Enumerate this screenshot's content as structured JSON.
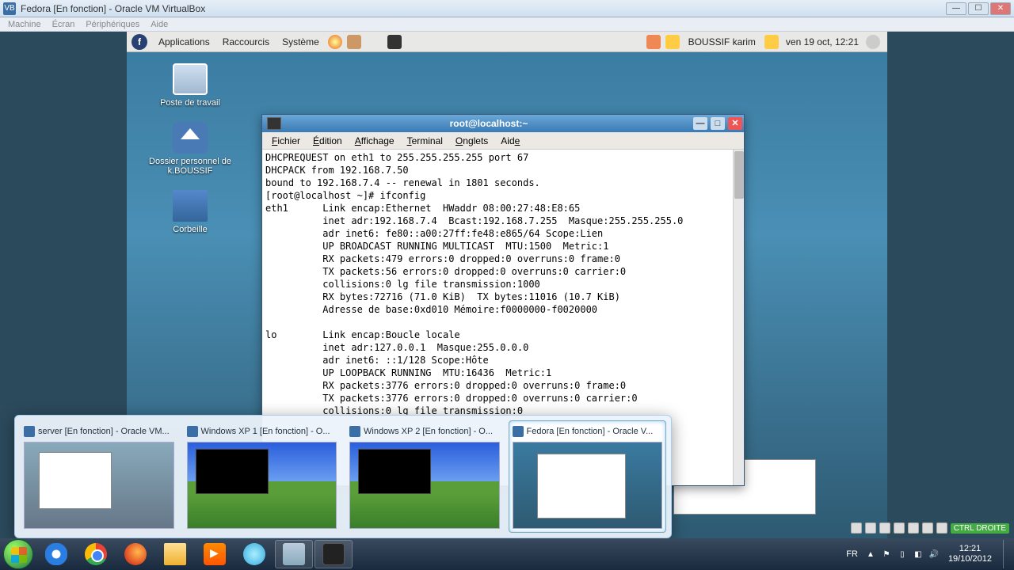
{
  "vbox": {
    "title": "Fedora [En fonction] - Oracle VM VirtualBox",
    "menu": [
      "Machine",
      "Écran",
      "Périphériques",
      "Aide"
    ],
    "hostkey": "CTRL DROITE"
  },
  "gnome": {
    "menus": {
      "apps": "Applications",
      "places": "Raccourcis",
      "system": "Système"
    },
    "user": "BOUSSIF karim",
    "clock": "ven 19 oct, 12:21"
  },
  "desktop_icons": {
    "computer": "Poste de travail",
    "home": "Dossier personnel de k.BOUSSIF",
    "trash": "Corbeille"
  },
  "terminal": {
    "title": "root@localhost:~",
    "menu": {
      "file": "Fichier",
      "edit": "Édition",
      "view": "Affichage",
      "terminal": "Terminal",
      "tabs": "Onglets",
      "help": "Aide"
    },
    "output": "DHCPREQUEST on eth1 to 255.255.255.255 port 67\nDHCPACK from 192.168.7.50\nbound to 192.168.7.4 -- renewal in 1801 seconds.\n[root@localhost ~]# ifconfig\neth1      Link encap:Ethernet  HWaddr 08:00:27:48:E8:65\n          inet adr:192.168.7.4  Bcast:192.168.7.255  Masque:255.255.255.0\n          adr inet6: fe80::a00:27ff:fe48:e865/64 Scope:Lien\n          UP BROADCAST RUNNING MULTICAST  MTU:1500  Metric:1\n          RX packets:479 errors:0 dropped:0 overruns:0 frame:0\n          TX packets:56 errors:0 dropped:0 overruns:0 carrier:0\n          collisions:0 lg file transmission:1000\n          RX bytes:72716 (71.0 KiB)  TX bytes:11016 (10.7 KiB)\n          Adresse de base:0xd010 Mémoire:f0000000-f0020000\n\nlo        Link encap:Boucle locale\n          inet adr:127.0.0.1  Masque:255.0.0.0\n          adr inet6: ::1/128 Scope:Hôte\n          UP LOOPBACK RUNNING  MTU:16436  Metric:1\n          RX packets:3776 errors:0 dropped:0 overruns:0 frame:0\n          TX packets:3776 errors:0 dropped:0 overruns:0 carrier:0\n          collisions:0 lg file transmission:0"
  },
  "previews": [
    {
      "label": "server [En fonction] - Oracle VM..."
    },
    {
      "label": "Windows XP 1 [En fonction] - O..."
    },
    {
      "label": "Windows XP 2 [En fonction] - O..."
    },
    {
      "label": "Fedora [En fonction] - Oracle V..."
    }
  ],
  "win_tray": {
    "lang": "FR",
    "time": "12:21",
    "date": "19/10/2012"
  }
}
